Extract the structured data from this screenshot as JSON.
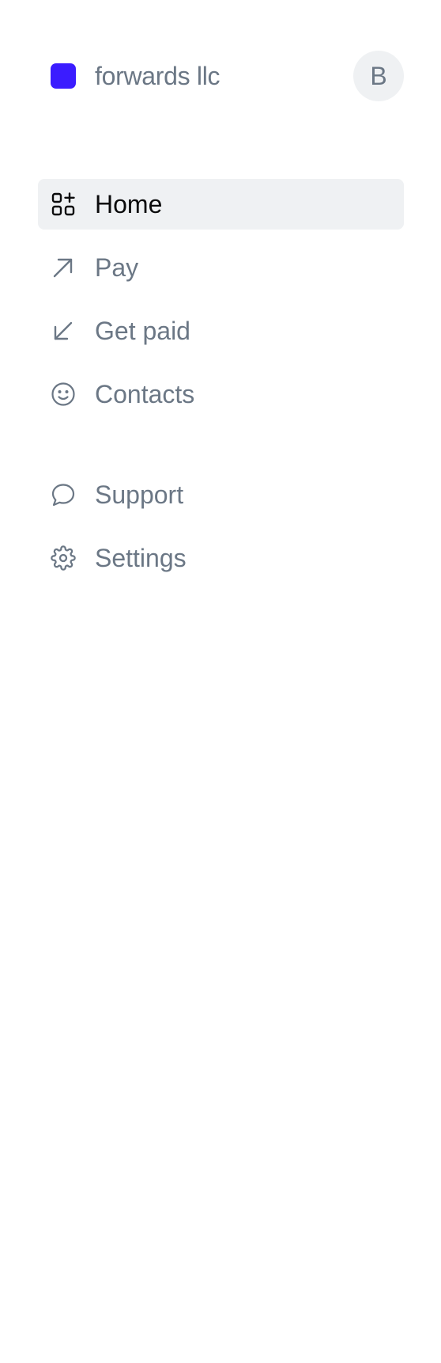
{
  "colors": {
    "brand_square": "#3b1cff",
    "text_muted": "#6b7785",
    "text_active": "#0b0b0c",
    "active_bg": "#eff1f3"
  },
  "header": {
    "org_name": "forwards llc",
    "avatar_initial": "B"
  },
  "nav": {
    "primary": [
      {
        "label": "Home",
        "icon": "home-grid-plus-icon",
        "active": true
      },
      {
        "label": "Pay",
        "icon": "arrow-up-right-icon",
        "active": false
      },
      {
        "label": "Get paid",
        "icon": "arrow-down-left-icon",
        "active": false
      },
      {
        "label": "Contacts",
        "icon": "smiley-icon",
        "active": false
      }
    ],
    "secondary": [
      {
        "label": "Support",
        "icon": "chat-bubble-icon",
        "active": false
      },
      {
        "label": "Settings",
        "icon": "gear-icon",
        "active": false
      }
    ]
  }
}
